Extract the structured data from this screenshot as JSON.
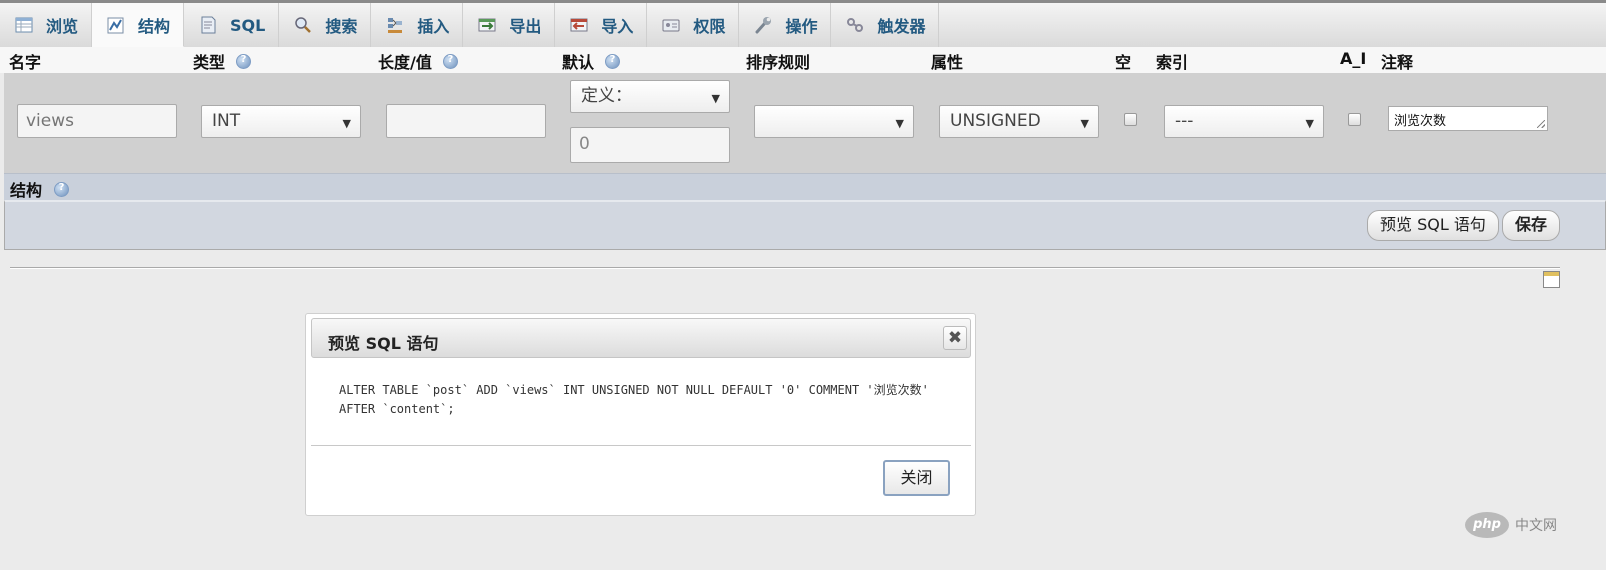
{
  "tabs": [
    {
      "label": "浏览",
      "icon": "browse-icon"
    },
    {
      "label": "结构",
      "icon": "structure-icon",
      "active": true
    },
    {
      "label": "SQL",
      "icon": "sql-icon"
    },
    {
      "label": "搜索",
      "icon": "search-icon"
    },
    {
      "label": "插入",
      "icon": "insert-icon"
    },
    {
      "label": "导出",
      "icon": "export-icon"
    },
    {
      "label": "导入",
      "icon": "import-icon"
    },
    {
      "label": "权限",
      "icon": "privileges-icon"
    },
    {
      "label": "操作",
      "icon": "wrench-icon"
    },
    {
      "label": "触发器",
      "icon": "triggers-icon"
    }
  ],
  "columns": {
    "name": "名字",
    "type": "类型",
    "length": "长度/值",
    "default": "默认",
    "collation": "排序规则",
    "attributes": "属性",
    "null": "空",
    "index": "索引",
    "ai": "A_I",
    "comment": "注释"
  },
  "field": {
    "name_placeholder": "views",
    "type": "INT",
    "length": "",
    "default_kind": "定义：",
    "default_value": "0",
    "collation": "",
    "attribute": "UNSIGNED",
    "null_checked": false,
    "index": "---",
    "ai_checked": false,
    "comment": "浏览次数"
  },
  "structure_label": "结构",
  "actions": {
    "preview_sql": "预览 SQL 语句",
    "save": "保存"
  },
  "dialog": {
    "title": "预览 SQL 语句",
    "close_glyph": "✖",
    "sql_line1": "ALTER TABLE `post` ADD `views` INT UNSIGNED NOT NULL DEFAULT '0' COMMENT '浏览次数'",
    "sql_line2": "AFTER `content`;",
    "close_button": "关闭"
  },
  "watermark": {
    "badge": "php",
    "text": "中文网"
  }
}
